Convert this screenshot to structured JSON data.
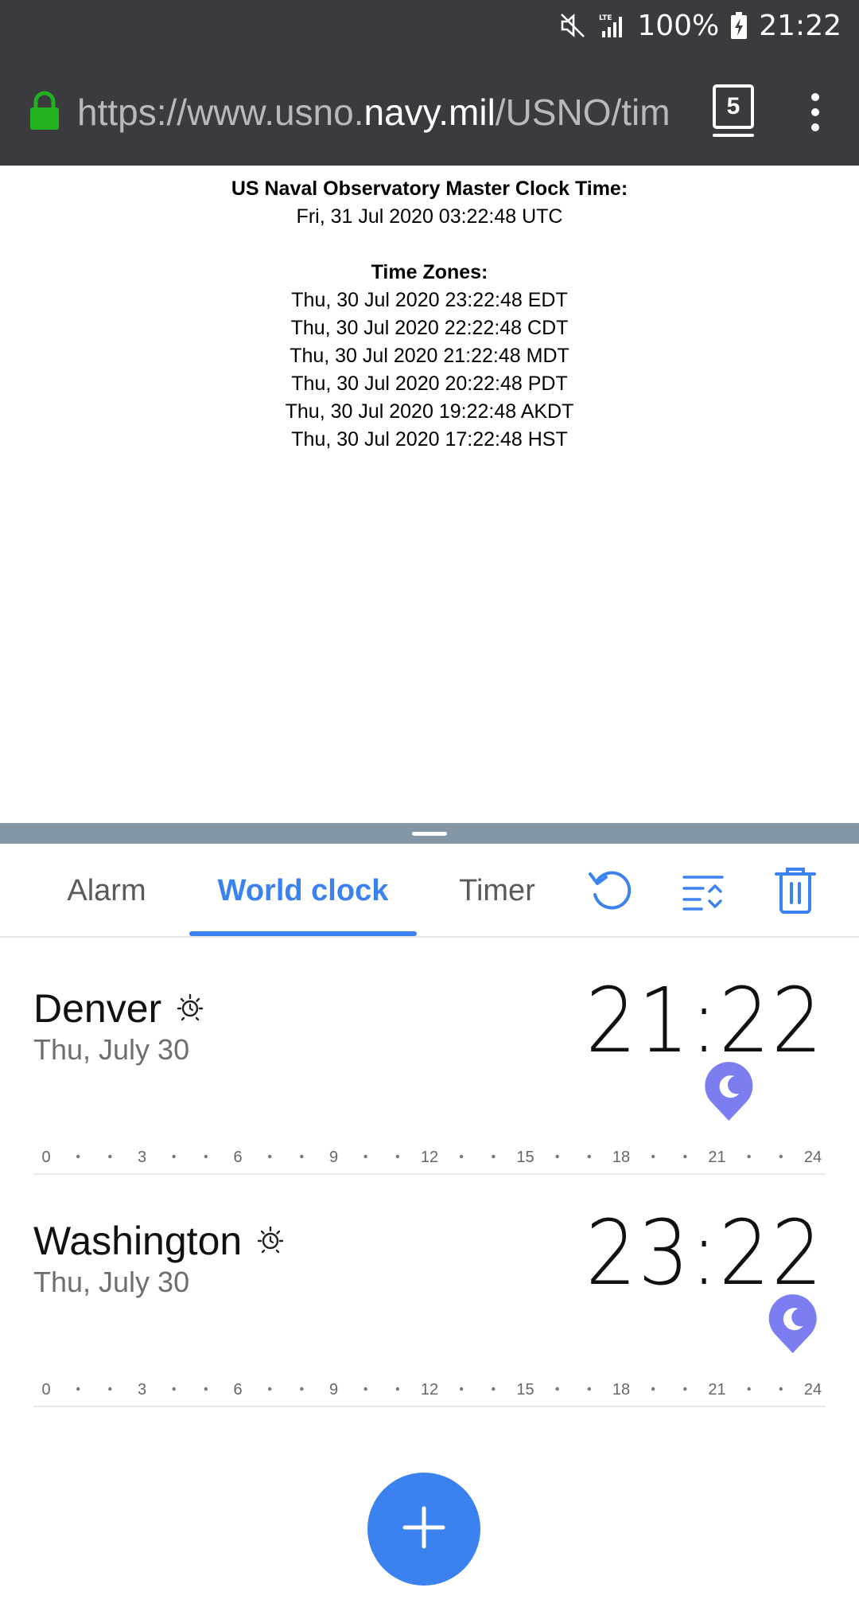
{
  "status_bar": {
    "icons": [
      "mute-icon",
      "lte-signal-icon",
      "battery-charging-icon"
    ],
    "battery": "100%",
    "time": "21:22"
  },
  "browser": {
    "url_prefix": "https://www.usno.",
    "url_host": "navy.mil",
    "url_suffix": "/USNO/tim",
    "tab_count": "5",
    "colors": {
      "lock": "#22b21f",
      "toolbar": "#3b3b3f"
    }
  },
  "webpage": {
    "master_title": "US Naval Observatory Master Clock Time:",
    "master_time": "Fri, 31 Jul 2020 03:22:48 UTC",
    "zones_title": "Time Zones:",
    "zones": [
      "Thu, 30 Jul 2020 23:22:48 EDT",
      "Thu, 30 Jul 2020 22:22:48 CDT",
      "Thu, 30 Jul 2020 21:22:48 MDT",
      "Thu, 30 Jul 2020 20:22:48 PDT",
      "Thu, 30 Jul 2020 19:22:48 AKDT",
      "Thu, 30 Jul 2020 17:22:48 HST"
    ]
  },
  "clock_app": {
    "accent": "#3b82f0",
    "tabs": [
      {
        "label": "Alarm"
      },
      {
        "label": "World clock",
        "active": true
      },
      {
        "label": "Timer"
      }
    ],
    "toolbar_icons": [
      "reset-icon",
      "reorder-icon",
      "delete-icon"
    ],
    "timeline_labels": [
      "0",
      "3",
      "6",
      "9",
      "12",
      "15",
      "18",
      "21",
      "24"
    ],
    "cities": [
      {
        "name": "Denver",
        "date": "Thu, July 30",
        "time": "21:22",
        "hour": 21.37,
        "day_icon": "sun-icon",
        "marker_icon": "moon-icon"
      },
      {
        "name": "Washington",
        "date": "Thu, July 30",
        "time": "23:22",
        "hour": 23.37,
        "day_icon": "sun-icon",
        "marker_icon": "moon-icon"
      }
    ],
    "fab_icon": "plus-icon"
  }
}
